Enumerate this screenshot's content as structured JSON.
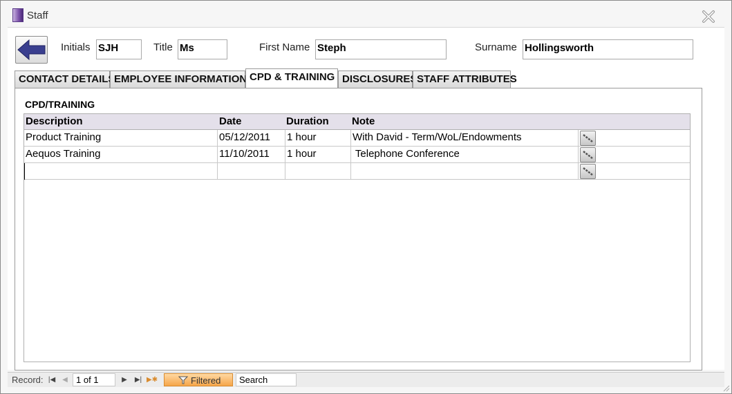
{
  "window": {
    "title": "Staff"
  },
  "header": {
    "initials_label": "Initials",
    "initials_value": "SJH",
    "title_label": "Title",
    "title_value": "Ms",
    "first_name_label": "First Name",
    "first_name_value": "Steph",
    "surname_label": "Surname",
    "surname_value": "Hollingsworth"
  },
  "tabs": [
    {
      "label": "CONTACT DETAILS"
    },
    {
      "label": "EMPLOYEE INFORMATION"
    },
    {
      "label": "CPD & TRAINING"
    },
    {
      "label": "DISCLOSURES"
    },
    {
      "label": "STAFF ATTRIBUTES"
    }
  ],
  "active_tab": "CPD & TRAINING",
  "section": {
    "title": "CPD/TRAINING"
  },
  "grid": {
    "columns": [
      "Description",
      "Date",
      "Duration",
      "Note"
    ],
    "rows": [
      {
        "description": "Product Training",
        "date": "05/12/2011",
        "duration": "1 hour",
        "note": "With David - Term/WoL/Endowments"
      },
      {
        "description": "Aequos Training",
        "date": "11/10/2011",
        "duration": "1 hour",
        "note": " Telephone Conference"
      },
      {
        "description": "",
        "date": "",
        "duration": "",
        "note": ""
      }
    ]
  },
  "navigation": {
    "record_label": "Record:",
    "position": "1 of 1",
    "filter_label": "Filtered",
    "search_placeholder": "Search"
  },
  "colors": {
    "back_arrow": "#3a3f8f",
    "grid_header": "#e4e0ea",
    "filter_accent": "#f5a54a"
  },
  "icons": [
    "app-icon",
    "close-icon",
    "back-arrow-icon",
    "attachment-icon",
    "first-record-icon",
    "previous-record-icon",
    "next-record-icon",
    "last-record-icon",
    "new-record-icon",
    "filter-icon"
  ]
}
